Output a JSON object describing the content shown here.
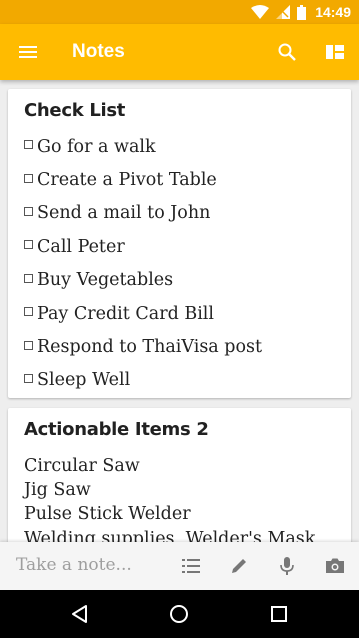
{
  "status_bar": {
    "time": "14:49",
    "icons": [
      "wifi-icon",
      "signal-icon",
      "battery-icon"
    ]
  },
  "app_bar": {
    "title": "Notes",
    "icons": [
      "menu-icon",
      "search-icon",
      "layout-icon"
    ]
  },
  "notes": [
    {
      "title": "Check List",
      "items": [
        "Go for a walk",
        "Create a Pivot Table",
        "Send a mail to John",
        "Call Peter",
        "Buy Vegetables",
        "Pay Credit Card Bill",
        "Respond to ThaiVisa post",
        "Sleep Well"
      ]
    },
    {
      "title": "Actionable Items 2",
      "lines": [
        "Circular Saw",
        "Jig Saw",
        "Pulse Stick Welder",
        "Welding supplies, Welder's Mask,"
      ]
    }
  ],
  "bottom_bar": {
    "placeholder": "Take a note...",
    "icons": [
      "list-icon",
      "pen-icon",
      "mic-icon",
      "camera-icon"
    ]
  },
  "nav_bar": {
    "icons": [
      "back-icon",
      "home-icon",
      "recents-icon"
    ]
  },
  "colors": {
    "status_bar": "#f2a900",
    "app_bar": "#ffbb00",
    "background": "#eeeeee"
  }
}
